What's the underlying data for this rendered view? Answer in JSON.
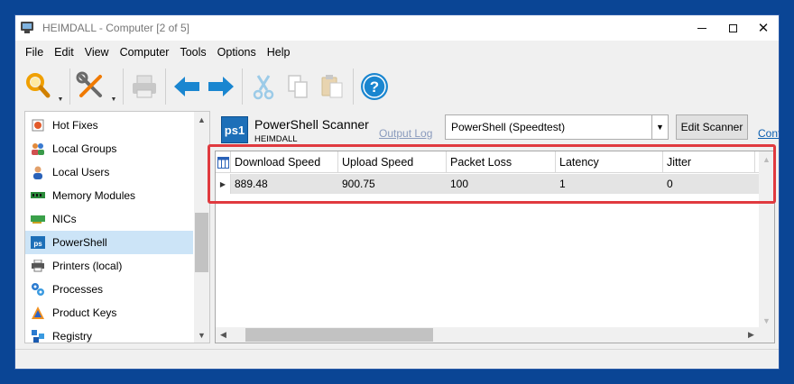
{
  "window": {
    "title": "HEIMDALL - Computer [2 of 5]"
  },
  "menu": [
    "File",
    "Edit",
    "View",
    "Computer",
    "Tools",
    "Options",
    "Help"
  ],
  "toolbar": {
    "buttons": [
      "search-icon",
      "tools-icon",
      "print-icon",
      "back-arrow-icon",
      "forward-arrow-icon",
      "cut-icon",
      "copy-icon",
      "paste-icon",
      "help-icon"
    ]
  },
  "sidebar": {
    "items": [
      {
        "label": "Hot Fixes",
        "icon": "hotfix-icon"
      },
      {
        "label": "Local Groups",
        "icon": "group-icon"
      },
      {
        "label": "Local Users",
        "icon": "user-icon"
      },
      {
        "label": "Memory Modules",
        "icon": "memory-icon"
      },
      {
        "label": "NICs",
        "icon": "nic-icon"
      },
      {
        "label": "PowerShell",
        "icon": "powershell-icon"
      },
      {
        "label": "Printers (local)",
        "icon": "printer-icon"
      },
      {
        "label": "Processes",
        "icon": "process-icon"
      },
      {
        "label": "Product Keys",
        "icon": "key-icon"
      },
      {
        "label": "Registry",
        "icon": "registry-icon"
      }
    ],
    "selected_index": 5
  },
  "scanner": {
    "icon_text": "ps1",
    "title": "PowerShell Scanner",
    "subtitle": "HEIMDALL",
    "output_log": "Output Log",
    "script_selected": "PowerShell (Speedtest)",
    "edit_button": "Edit Scanner",
    "link_partial": "Configure"
  },
  "grid": {
    "columns": [
      "Download Speed",
      "Upload Speed",
      "Packet Loss",
      "Latency",
      "Jitter"
    ],
    "rows": [
      [
        "889.48",
        "900.75",
        "100",
        "1",
        "0"
      ]
    ]
  },
  "colors": {
    "desktop": "#0a4595",
    "highlight": "#e03a3f",
    "selected": "#cce4f7"
  }
}
